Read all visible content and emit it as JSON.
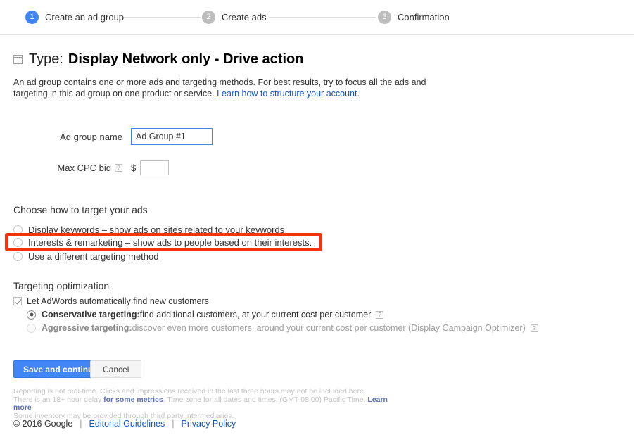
{
  "stepper": {
    "steps": [
      {
        "num": "1",
        "label": "Create an ad group",
        "state": "active"
      },
      {
        "num": "2",
        "label": "Create ads",
        "state": "inactive"
      },
      {
        "num": "3",
        "label": "Confirmation",
        "state": "inactive"
      }
    ]
  },
  "type_header": {
    "icon": "layout-panel-icon",
    "label": "Type:",
    "value": "Display Network only - Drive action"
  },
  "description": {
    "text_part1": "An ad group contains one or more ads and targeting methods. For best results, try to focus all the ads and targeting in this ad group on one product or service. ",
    "link_text": "Learn how to structure your account",
    "text_part2": "."
  },
  "form": {
    "ad_group_name": {
      "label": "Ad group name",
      "value": "Ad Group #1",
      "placeholder": ""
    },
    "max_cpc_bid": {
      "label": "Max CPC bid",
      "help": "?",
      "currency": "$",
      "value": "",
      "placeholder": ""
    }
  },
  "targeting": {
    "heading": "Choose how to target your ads",
    "options": [
      {
        "label": "Display keywords – show ads on sites related to your keywords",
        "selected": false
      },
      {
        "label": "Interests & remarketing – show ads to people based on their interests.",
        "selected": false
      },
      {
        "label": "Use a different targeting method",
        "selected": false
      }
    ],
    "highlight_color": "#f4320c"
  },
  "optimization": {
    "heading": "Targeting optimization",
    "checkbox": {
      "label": "Let AdWords automatically find new customers",
      "checked": true
    },
    "options": [
      {
        "bold": "Conservative targeting:",
        "rest": " find additional customers, at your current cost per customer",
        "help": "?",
        "selected": true,
        "disabled": false
      },
      {
        "bold": "Aggressive targeting:",
        "rest": " discover even more customers, around your current cost per customer (Display Campaign Optimizer)",
        "help": "?",
        "selected": false,
        "disabled": true
      }
    ]
  },
  "buttons": {
    "save": "Save and continue",
    "cancel": "Cancel"
  },
  "fineprint": {
    "line1": "Reporting is not real-time. Clicks and impressions received in the last three hours may not be included here.",
    "line2_a": "There is an 18+ hour delay ",
    "line2_link1": "for some metrics",
    "line2_b": ". Time zone for all dates and times: (GMT-08:00) Pacific Time. ",
    "line2_link2": "Learn more",
    "line3": "Some inventory may be provided through third party intermediaries."
  },
  "footer": {
    "copyright": "© 2016 Google",
    "sep1": "|",
    "editorial": "Editorial Guidelines",
    "sep2": "|",
    "privacy": "Privacy Policy"
  }
}
